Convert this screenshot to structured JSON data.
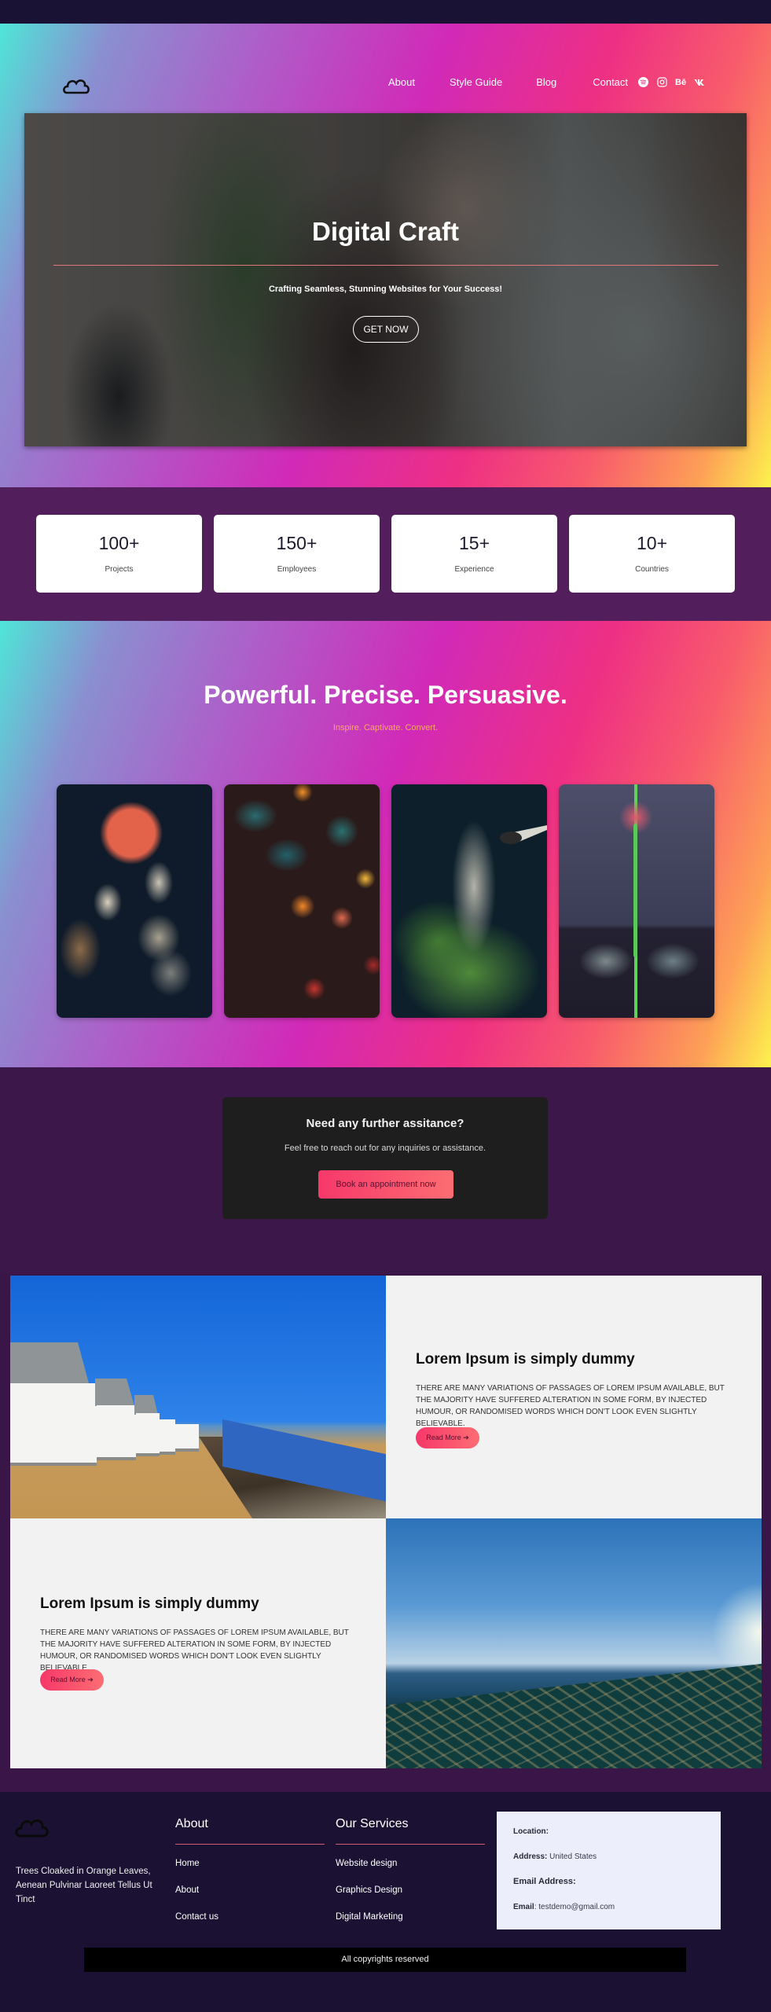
{
  "nav": {
    "logo": "cloud-logo",
    "links": [
      "About",
      "Style Guide",
      "Blog",
      "Contact"
    ],
    "social": [
      {
        "name": "spotify-icon",
        "glyph": "≋"
      },
      {
        "name": "instagram-icon",
        "glyph": "◎"
      },
      {
        "name": "behance-icon",
        "glyph": "Bē"
      },
      {
        "name": "vk-icon",
        "glyph": "vk"
      }
    ]
  },
  "hero": {
    "title": "Digital Craft",
    "tagline": "Crafting Seamless, Stunning Websites for Your Success!",
    "button": "GET NOW"
  },
  "stats": [
    {
      "value": "100+",
      "label": "Projects"
    },
    {
      "value": "150+",
      "label": "Employees"
    },
    {
      "value": "15+",
      "label": "Experience"
    },
    {
      "value": "10+",
      "label": "Countries"
    }
  ],
  "gallery": {
    "title": "Powerful. Precise. Persuasive.",
    "subtitle": "Inspire. Captivate. Convert.",
    "images": [
      "flower-on-stones",
      "orange-flowers-leaves",
      "watering-plants",
      "gerbera-between-stones"
    ]
  },
  "cta": {
    "title": "Need any further assitance?",
    "text": "Feel free to reach out for any inquiries or assistance.",
    "button": "Book an appointment now"
  },
  "features": [
    {
      "title": "Lorem Ipsum is simply dummy",
      "body": "There are many variations of passages of Lorem Ipsum available, but the majority have suffered alteration in some form, by injected humour, or randomised words which don't look even slightly believable.",
      "button": "Read More ➔",
      "image": "beach-cottages"
    },
    {
      "title": "Lorem Ipsum is simply dummy",
      "body": "There are many variations of passages of Lorem Ipsum available, but the majority have suffered alteration in some form, by injected humour, or randomised words which don't look even slightly believable.",
      "button": "Read More ➔",
      "image": "sandy-beach-sea"
    }
  ],
  "footer": {
    "description": "Trees Cloaked in Orange Leaves, Aenean Pulvinar Laoreet Tellus Ut Tinct",
    "about": {
      "heading": "About",
      "links": [
        "Home",
        "About",
        "Contact us"
      ]
    },
    "services": {
      "heading": "Our Services",
      "links": [
        "Website design",
        "Graphics Design",
        "Digital Marketing"
      ]
    },
    "contact": {
      "location_label": "Location:",
      "address_label": "Address:",
      "address_value": "United States",
      "email_heading": "Email Address:",
      "email_label": "Email",
      "email_value": "testdemo@gmail.com"
    },
    "copyright": "All copyrights reserved"
  },
  "colors": {
    "accent_pink": "#f6386a",
    "accent_coral": "#fd6d72",
    "stats_bg": "#521e5c",
    "cta_bg": "#3c174a",
    "footer_bg": "#1b1233",
    "subtitle_orange": "#fba46a"
  }
}
